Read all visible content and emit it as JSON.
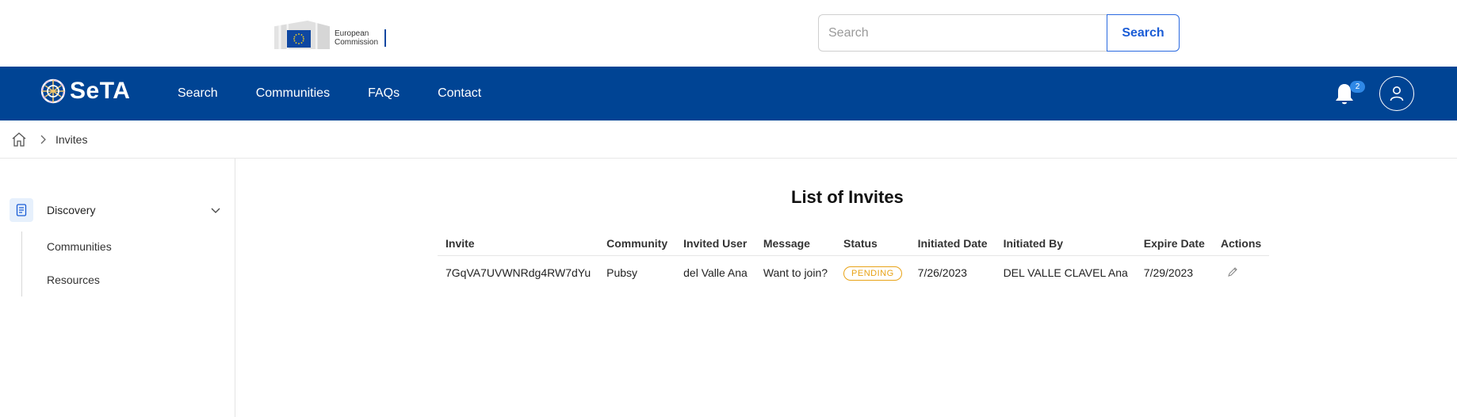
{
  "header": {
    "logo_text_line1": "European",
    "logo_text_line2": "Commission",
    "search_placeholder": "Search",
    "search_button": "Search"
  },
  "nav": {
    "brand": "SeTA",
    "links": [
      "Search",
      "Communities",
      "FAQs",
      "Contact"
    ],
    "notification_count": "2",
    "colors": {
      "bar": "#004494",
      "badge": "#2f88e6"
    }
  },
  "breadcrumb": {
    "current": "Invites"
  },
  "sidebar": {
    "group_label": "Discovery",
    "items": [
      "Communities",
      "Resources"
    ]
  },
  "main": {
    "title": "List of Invites",
    "columns": [
      "Invite",
      "Community",
      "Invited User",
      "Message",
      "Status",
      "Initiated Date",
      "Initiated By",
      "Expire Date",
      "Actions"
    ],
    "rows": [
      {
        "invite": "7GqVA7UVWNRdg4RW7dYu",
        "community": "Pubsy",
        "invited_user": "del Valle Ana",
        "message": "Want to join?",
        "status": "PENDING",
        "initiated_date": "7/26/2023",
        "initiated_by": "DEL VALLE CLAVEL Ana",
        "expire_date": "7/29/2023"
      }
    ],
    "status_color": "#e8a317"
  }
}
